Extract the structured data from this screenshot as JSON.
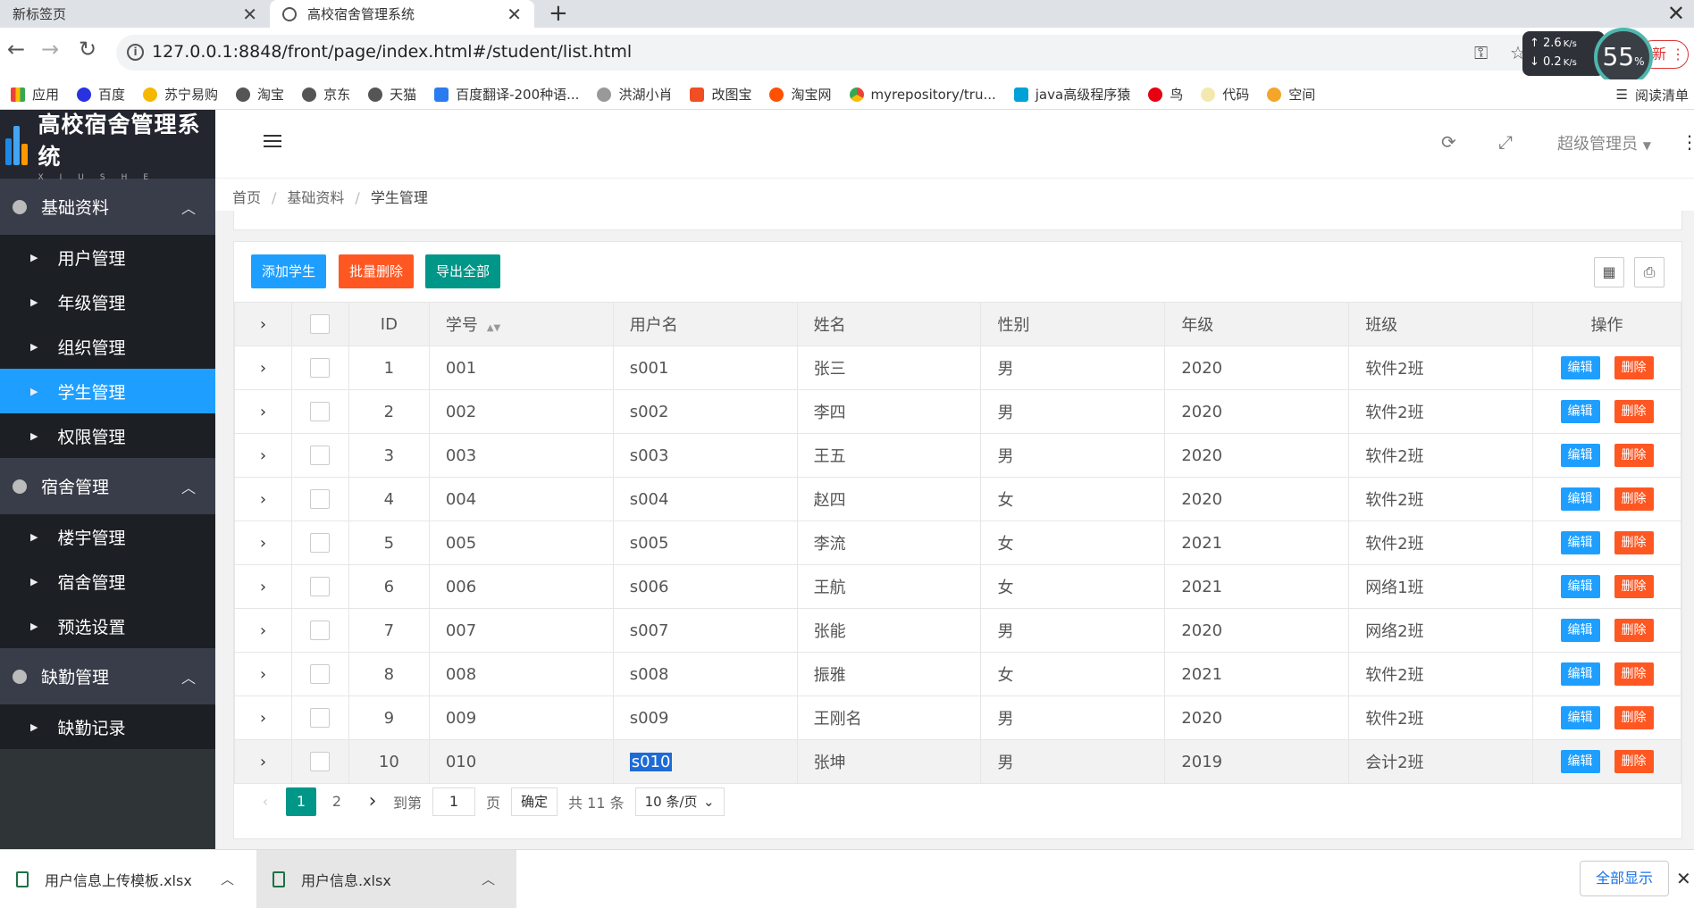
{
  "browser": {
    "tabs": [
      {
        "title": "新标签页"
      },
      {
        "title": "高校宿舍管理系统"
      }
    ],
    "url": "127.0.0.1:8848/front/page/index.html#/student/list.html",
    "netspeed": {
      "up": "2.6",
      "down": "0.2",
      "unit": "K/s"
    },
    "cpu": "55",
    "cpu_unit": "%",
    "update_badge": "新",
    "bookmarks": [
      "应用",
      "百度",
      "苏宁易购",
      "淘宝",
      "京东",
      "天猫",
      "百度翻译-200种语...",
      "洪湖小肖",
      "改图宝",
      "淘宝网",
      "myrepository/tru...",
      "java高级程序猿",
      "鸟",
      "代码",
      "空间"
    ],
    "reading_list": "阅读清单"
  },
  "sidebar": {
    "logo_text": "高校宿舍管理系统",
    "logo_sub": "XIUSHE",
    "groups": [
      {
        "label": "基础资料",
        "items": [
          "用户管理",
          "年级管理",
          "组织管理",
          "学生管理",
          "权限管理"
        ]
      },
      {
        "label": "宿舍管理",
        "items": [
          "楼宇管理",
          "宿舍管理",
          "预选设置"
        ]
      },
      {
        "label": "缺勤管理",
        "items": [
          "缺勤记录"
        ]
      }
    ],
    "active_item": "学生管理"
  },
  "header": {
    "admin": "超级管理员"
  },
  "breadcrumb": [
    "首页",
    "基础资料",
    "学生管理"
  ],
  "toolbar": {
    "add": "添加学生",
    "batch_delete": "批量删除",
    "export_all": "导出全部"
  },
  "colors": {
    "blue": "#1e9fff",
    "red": "#ff5722",
    "green": "#009688",
    "sidebar": "#2f3437"
  },
  "table": {
    "columns": [
      "ID",
      "学号",
      "用户名",
      "姓名",
      "性别",
      "年级",
      "班级",
      "操作"
    ],
    "rows": [
      [
        "1",
        "001",
        "s001",
        "张三",
        "男",
        "2020",
        "软件2班"
      ],
      [
        "2",
        "002",
        "s002",
        "李四",
        "男",
        "2020",
        "软件2班"
      ],
      [
        "3",
        "003",
        "s003",
        "王五",
        "男",
        "2020",
        "软件2班"
      ],
      [
        "4",
        "004",
        "s004",
        "赵四",
        "女",
        "2020",
        "软件2班"
      ],
      [
        "5",
        "005",
        "s005",
        "李流",
        "女",
        "2021",
        "软件2班"
      ],
      [
        "6",
        "006",
        "s006",
        "王航",
        "女",
        "2021",
        "网络1班"
      ],
      [
        "7",
        "007",
        "s007",
        "张能",
        "男",
        "2020",
        "网络2班"
      ],
      [
        "8",
        "008",
        "s008",
        "振雅",
        "女",
        "2021",
        "软件2班"
      ],
      [
        "9",
        "009",
        "s009",
        "王刚名",
        "男",
        "2020",
        "软件2班"
      ],
      [
        "10",
        "010",
        "s010",
        "张坤",
        "男",
        "2019",
        "会计2班"
      ]
    ],
    "edit_label": "编辑",
    "delete_label": "删除"
  },
  "pager": {
    "pages": [
      "1",
      "2"
    ],
    "current": "1",
    "goto_prefix": "到第",
    "goto_value": "1",
    "goto_suffix": "页",
    "confirm": "确定",
    "total": "共 11 条",
    "page_size": "10 条/页"
  },
  "downloads": {
    "files": [
      "用户信息上传模板.xlsx",
      "用户信息.xlsx"
    ],
    "show_all": "全部显示"
  }
}
